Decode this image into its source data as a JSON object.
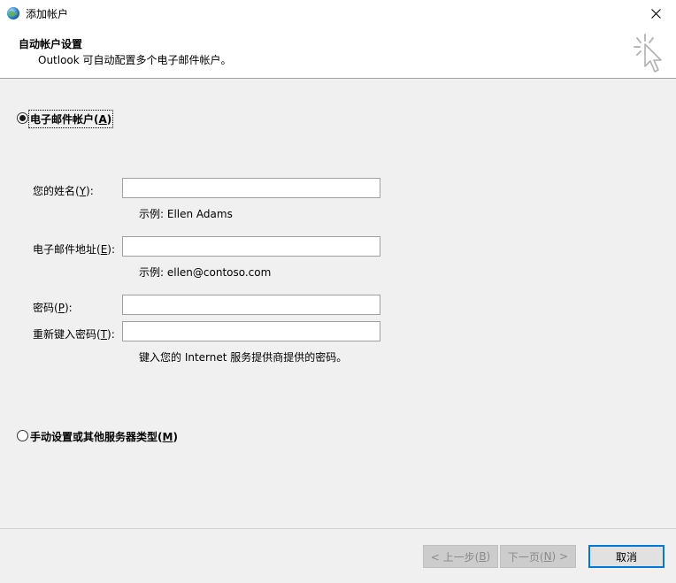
{
  "window": {
    "title": "添加帐户"
  },
  "header": {
    "title": "自动帐户设置",
    "subtitle": "Outlook 可自动配置多个电子邮件帐户。"
  },
  "options": {
    "email_account": {
      "label_main": "电子邮件帐户(",
      "label_key": "A",
      "label_end": ")",
      "selected": true
    },
    "manual": {
      "label_main": "手动设置或其他服务器类型(",
      "label_key": "M",
      "label_end": ")",
      "selected": false
    }
  },
  "form": {
    "name": {
      "label_main": "您的姓名(",
      "label_key": "Y",
      "label_end": "):",
      "value": "",
      "hint": "示例: Ellen Adams"
    },
    "email": {
      "label_main": "电子邮件地址(",
      "label_key": "E",
      "label_end": "):",
      "value": "",
      "hint": "示例: ellen@contoso.com"
    },
    "password": {
      "label_main": "密码(",
      "label_key": "P",
      "label_end": "):",
      "value": ""
    },
    "password_confirm": {
      "label_main": "重新键入密码(",
      "label_key": "T",
      "label_end": "):",
      "value": ""
    },
    "password_hint": "键入您的 Internet 服务提供商提供的密码。"
  },
  "buttons": {
    "back": {
      "label_main": "< 上一步(",
      "label_key": "B",
      "label_end": ")"
    },
    "next": {
      "label_main": "下一页(",
      "label_key": "N",
      "label_end": ") >"
    },
    "cancel": {
      "label": "取消"
    }
  },
  "icons": {
    "app": "outlook-globe-icon",
    "close": "close-icon",
    "header": "cursor-sparkle-icon"
  }
}
